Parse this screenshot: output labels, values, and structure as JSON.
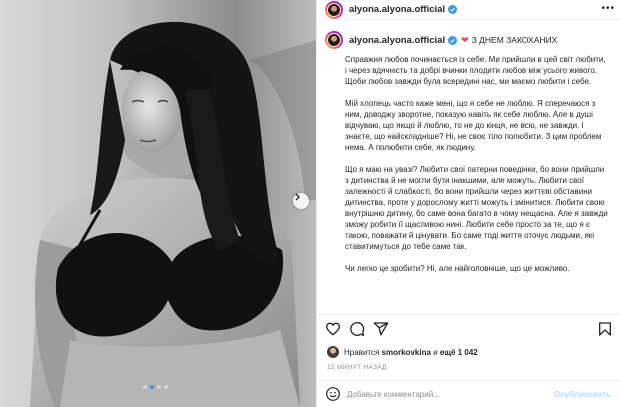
{
  "post": {
    "username": "alyona.alyona.official",
    "caption_title": "З ДНЕМ ЗАКОХАНИХ",
    "paragraphs": [
      "Справжня любов починається із себе. Ми прийшли в цей світ любити, і через вдячність та добрі вчинки плодити любов між усього живого. Щоби любов завжди була всередині нас, ми маємо любити і себе.",
      "Мій хлопець часто каже мені, що я себе не люблю. Я сперечаюся з ним, доводжу зворотне, показую навіть як себе люблю. Але в душі відчуваю, що якщо й люблю, то не до кінця, не всю, не завжди. І знаєте, що найскладніше? Ні, не своє тіло полюбити. З цим проблем нема. А полюбити себе, як людину.",
      "Що я маю на увазі? Любити свої патерни поведінки, бо вони прийшли з дитинства й не могли бути інакшими, але можуть. Любити свої залежності й слабкості, бо вони прийшли через життєві обставини дитинства, проте у дорослому житті можуть і змінитися. Любити свою внутрішню дитину, бо саме вона багато в чому нещасна. Але я завжди зможу робити її щасливою нині. Любити себе просто за те, що я є такою, поважати й цінувати. Бо саме тоді життя оточує людьми, які ставитимуться до тебе саме так.",
      "Чи легко це зробити? Ні, але найголовніше, що це можливо."
    ],
    "likes": {
      "prefix": "Нравится",
      "user": "smorkovkina",
      "connector": "и",
      "others": "ещё 1 042"
    },
    "timestamp": "12 МИНУТ НАЗАД",
    "comment": {
      "placeholder": "Добавьте комментарий...",
      "value": "",
      "publish_label": "Опубликовать"
    },
    "carousel": {
      "slides": 4,
      "active": 1
    }
  },
  "colors": {
    "verified": "#3897f0",
    "link_disabled": "#b2dffc",
    "muted": "#8e8e8e",
    "active_dot": "#3797f0",
    "heart_red": "#ed4956"
  },
  "icons": {
    "header_more": "more-icon",
    "like": "heart-icon",
    "comment": "comment-icon",
    "share": "share-icon",
    "save": "bookmark-icon",
    "emoji": "emoji-icon",
    "next": "chevron-right-icon",
    "verified": "verified-badge-icon",
    "title_emoji": "red-heart-emoji"
  }
}
